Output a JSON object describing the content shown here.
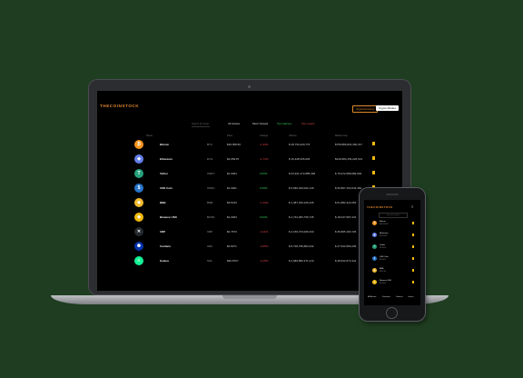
{
  "laptop": {
    "logo": "THECOINSTOCK",
    "header_buttons": {
      "primary_outline": "Cryptocurrency",
      "secondary": "Crypto Market"
    },
    "search_placeholder": "Search for Asset",
    "filter_tabs": [
      {
        "label": "All Assets",
        "tone": "neutral"
      },
      {
        "label": "Most Viewed",
        "tone": "neutral"
      },
      {
        "label": "Top Gainers",
        "tone": "pos"
      },
      {
        "label": "Top Losers",
        "tone": "neg"
      }
    ],
    "columns": [
      "Name",
      "Price",
      "Change",
      "Volume",
      "Market Cap"
    ],
    "rows": [
      {
        "name": "Bitcoin",
        "symbol": "BTC",
        "price": "$39,958.82",
        "change": "-1.34%",
        "change_tone": "neg",
        "volume": "$ 28,750,229,776",
        "cap": "$759,886,823,360,317",
        "icon_color": "#f7931a",
        "icon_glyph": "₿"
      },
      {
        "name": "Ethereum",
        "symbol": "ETH",
        "price": "$2,659.87",
        "change": "-1.71%",
        "change_tone": "neg",
        "volume": "$ 16,428,335,026",
        "cap": "$319,683,153,226,513",
        "icon_color": "#627eea",
        "icon_glyph": "◆"
      },
      {
        "name": "Tether",
        "symbol": "USDT",
        "price": "$1.0004",
        "change": "0.03%",
        "change_tone": "pos",
        "volume": "$ 63,921,472,885,306",
        "cap": "$ 79,972,588,089,903",
        "icon_color": "#26a17b",
        "icon_glyph": "T"
      },
      {
        "name": "USD Coin",
        "symbol": "USDC",
        "price": "$1.0001",
        "change": "0.03%",
        "change_tone": "pos",
        "volume": "$ 6,836,433,002,140",
        "cap": "$ 50,807,163,643,360",
        "icon_color": "#2775ca",
        "icon_glyph": "$"
      },
      {
        "name": "BNB",
        "symbol": "BNB",
        "price": "$379.84",
        "change": "-1.44%",
        "change_tone": "neg",
        "volume": "$ 1,387,916,226,225",
        "cap": "$ 61,882,323,253",
        "icon_color": "#f3ba2f",
        "icon_glyph": "◈"
      },
      {
        "name": "Binance USD",
        "symbol": "BUSD",
        "price": "$1.0003",
        "change": "0.03%",
        "change_tone": "pos",
        "volume": "$ 4,734,284,756,745",
        "cap": "$ 18,047,587,231",
        "icon_color": "#f0b90b",
        "icon_glyph": "◈"
      },
      {
        "name": "XRP",
        "symbol": "XRP",
        "price": "$0.7673",
        "change": "-2.11%",
        "change_tone": "neg",
        "volume": "$ 2,156,473,006,333",
        "cap": "$ 35,865,183,726",
        "icon_color": "#23292f",
        "icon_glyph": "✕"
      },
      {
        "name": "Cardano",
        "symbol": "ADA",
        "price": "$0.8271",
        "change": "-2.05%",
        "change_tone": "neg",
        "volume": "$ 8,738,795,884,332",
        "cap": "$ 27,522,583,236",
        "icon_color": "#0033ad",
        "icon_glyph": "✺"
      },
      {
        "name": "Solana",
        "symbol": "SOL",
        "price": "$90.8767",
        "change": "-3.15%",
        "change_tone": "neg",
        "volume": "$ 4,686,896,371,213",
        "cap": "$ 28,622,574,341",
        "icon_color": "#14f195",
        "icon_glyph": "≡"
      }
    ]
  },
  "phone": {
    "logo": "THECOINSTOCK",
    "menu_glyph": "≡",
    "search_placeholder": "Search for Asset",
    "rows": [
      {
        "name": "Bitcoin",
        "price": "$39,958.82",
        "icon_color": "#f7931a",
        "icon_glyph": "₿"
      },
      {
        "name": "Ethereum",
        "price": "$2,659.87",
        "icon_color": "#627eea",
        "icon_glyph": "◆"
      },
      {
        "name": "Tether",
        "price": "$1.0004",
        "icon_color": "#26a17b",
        "icon_glyph": "T"
      },
      {
        "name": "USD Coin",
        "price": "$1.0001",
        "icon_color": "#2775ca",
        "icon_glyph": "$"
      },
      {
        "name": "BNB",
        "price": "$379.84",
        "icon_color": "#f3ba2f",
        "icon_glyph": "◈"
      },
      {
        "name": "Binance USD",
        "price": "$1.0003",
        "icon_color": "#f0b90b",
        "icon_glyph": "◈"
      }
    ],
    "nav": [
      "All Assets",
      "Favorites",
      "Gainers",
      "Losers"
    ]
  },
  "colors": {
    "background": "#1f3d21",
    "accent": "#e08a2c",
    "positive": "#34d058",
    "negative": "#e5484d",
    "star": "#f1b90b"
  }
}
